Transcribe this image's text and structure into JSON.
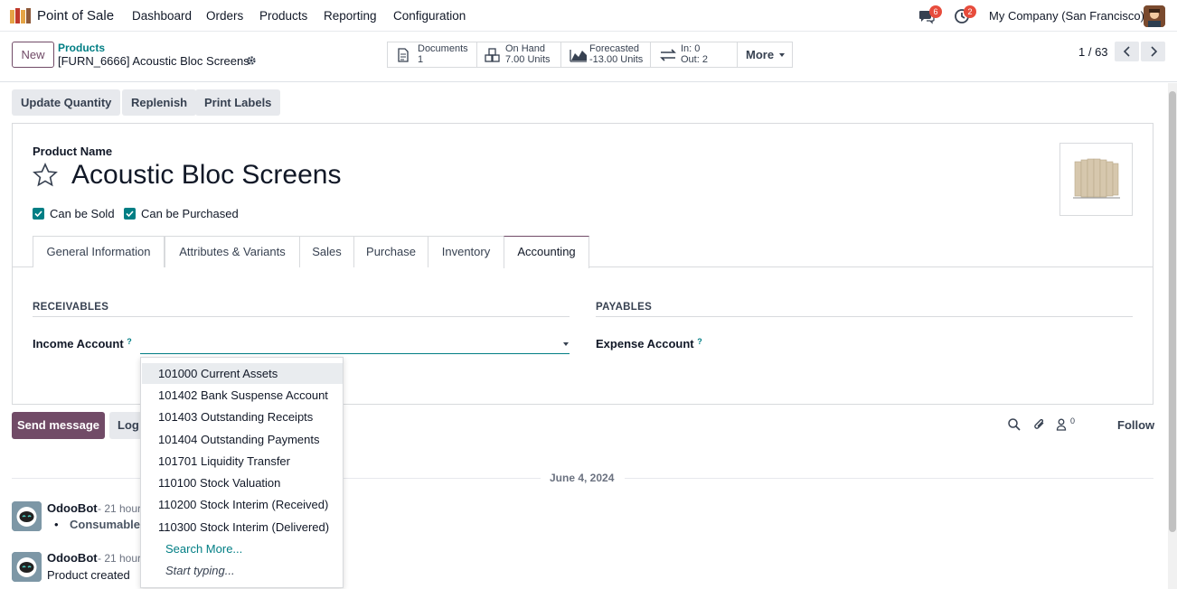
{
  "navbar": {
    "app_name": "Point of Sale",
    "menu": [
      "Dashboard",
      "Orders",
      "Products",
      "Reporting",
      "Configuration"
    ],
    "messages_count": "6",
    "activities_count": "2",
    "company": "My Company (San Francisco)"
  },
  "control_panel": {
    "new_label": "New",
    "breadcrumb": "Products",
    "record": "[FURN_6666] Acoustic Bloc Screens",
    "smart_buttons": {
      "documents": {
        "label": "Documents",
        "value": "1"
      },
      "on_hand": {
        "label": "On Hand",
        "value": "7.00 Units"
      },
      "forecasted": {
        "label": "Forecasted",
        "value": "-13.00 Units"
      },
      "moves": {
        "in": "In: 0",
        "out": "Out: 2"
      },
      "more": "More"
    },
    "pager": "1 / 63"
  },
  "actions": [
    "Update Quantity",
    "Replenish",
    "Print Labels"
  ],
  "form": {
    "product_name_label": "Product Name",
    "product_name": "Acoustic Bloc Screens",
    "can_be_sold": "Can be Sold",
    "can_be_purchased": "Can be Purchased",
    "tabs": [
      "General Information",
      "Attributes & Variants",
      "Sales",
      "Purchase",
      "Inventory",
      "Accounting"
    ],
    "active_tab": "Accounting",
    "receivables_title": "RECEIVABLES",
    "payables_title": "PAYABLES",
    "income_account_label": "Income Account",
    "expense_account_label": "Expense Account",
    "help_mark": "?"
  },
  "dropdown": {
    "items": [
      "101000 Current Assets",
      "101402 Bank Suspense Account",
      "101403 Outstanding Receipts",
      "101404 Outstanding Payments",
      "101701 Liquidity Transfer",
      "110100 Stock Valuation",
      "110200 Stock Interim (Received)",
      "110300 Stock Interim (Delivered)"
    ],
    "search_more": "Search More...",
    "start_typing": "Start typing..."
  },
  "chatter": {
    "send_message": "Send message",
    "log_note": "Log",
    "followers_count": "0",
    "follow": "Follow",
    "date": "June 4, 2024",
    "messages": [
      {
        "author": "OdooBot",
        "time": "- 21 hour",
        "body": "Consumable"
      },
      {
        "author": "OdooBot",
        "time": "- 21 hour",
        "body": "Product created"
      }
    ]
  },
  "colors": {
    "brand": "#714b67",
    "accent": "#017e84"
  }
}
